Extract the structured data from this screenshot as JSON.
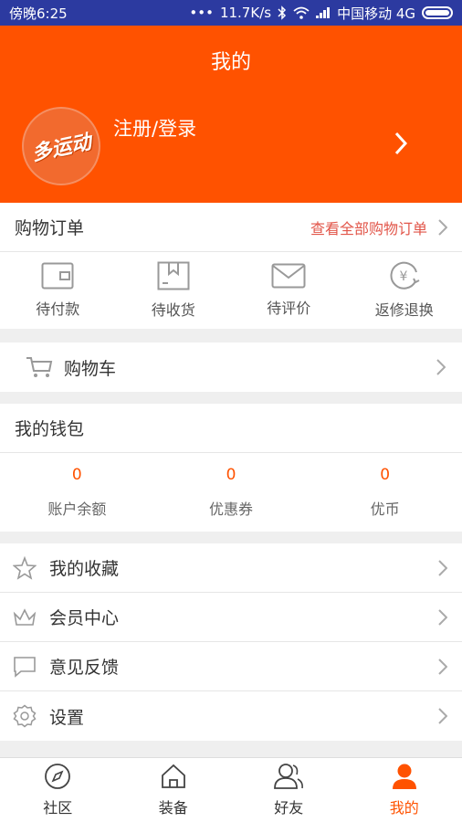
{
  "status_bar": {
    "time": "傍晚6:25",
    "speed": "11.7K/s",
    "carrier": "中国移动 4G"
  },
  "header": {
    "title": "我的",
    "login": "注册/登录",
    "logo_text": "多运动"
  },
  "orders": {
    "title": "购物订单",
    "view_all": "查看全部购物订单",
    "items": [
      {
        "label": "待付款",
        "icon": "wallet-icon"
      },
      {
        "label": "待收货",
        "icon": "box-icon"
      },
      {
        "label": "待评价",
        "icon": "envelope-icon"
      },
      {
        "label": "返修退换",
        "icon": "yuan-return-icon"
      }
    ]
  },
  "cart": {
    "label": "购物车"
  },
  "wallet": {
    "title": "我的钱包",
    "items": [
      {
        "value": "0",
        "label": "账户余额"
      },
      {
        "value": "0",
        "label": "优惠券"
      },
      {
        "value": "0",
        "label": "优币"
      }
    ]
  },
  "menu": [
    {
      "label": "我的收藏",
      "icon": "star-icon"
    },
    {
      "label": "会员中心",
      "icon": "crown-icon"
    },
    {
      "label": "意见反馈",
      "icon": "chat-icon"
    },
    {
      "label": "设置",
      "icon": "gear-icon"
    }
  ],
  "tabs": [
    {
      "label": "社区",
      "icon": "compass-icon"
    },
    {
      "label": "装备",
      "icon": "home-icon"
    },
    {
      "label": "好友",
      "icon": "friends-icon"
    },
    {
      "label": "我的",
      "icon": "user-icon",
      "active": true
    }
  ],
  "colors": {
    "accent": "#ff5200",
    "status_bar": "#2c3aa0",
    "link": "#e2564a"
  }
}
